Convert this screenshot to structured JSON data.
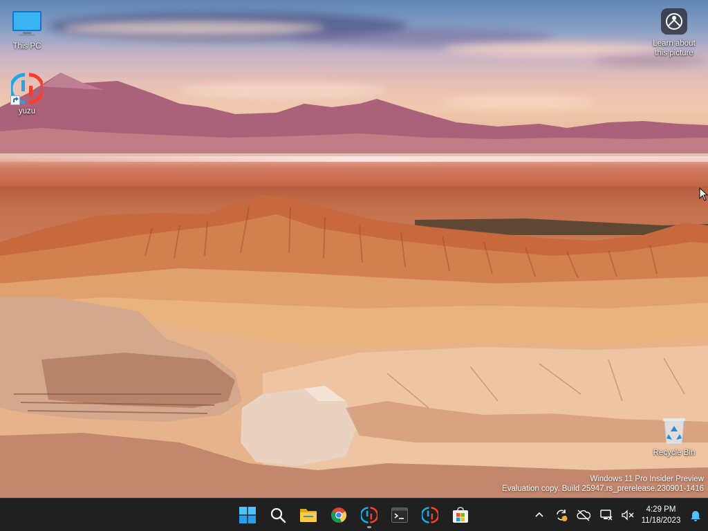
{
  "desktop": {
    "icons": [
      {
        "label": "This PC",
        "icon": "this-pc-icon"
      },
      {
        "label": "yuzu",
        "icon": "yuzu-icon"
      },
      {
        "label": "Recycle Bin",
        "icon": "recycle-bin-icon"
      }
    ],
    "learn_about": {
      "line1": "Learn about",
      "line2": "this picture",
      "icon": "camera-info-icon"
    }
  },
  "watermark": {
    "line1": "Windows 11 Pro Insider Preview",
    "line2": "Evaluation copy. Build 25947.rs_prerelease.230901-1416"
  },
  "taskbar": {
    "apps": [
      {
        "name": "start-button",
        "icon": "windows-logo-icon"
      },
      {
        "name": "search-button",
        "icon": "search-icon"
      },
      {
        "name": "file-explorer-button",
        "icon": "folder-icon"
      },
      {
        "name": "chrome-button",
        "icon": "chrome-icon"
      },
      {
        "name": "yuzu-taskbar-button",
        "icon": "yuzu-icon",
        "active": true
      },
      {
        "name": "terminal-button",
        "icon": "terminal-icon"
      },
      {
        "name": "yuzu-taskbar-button-2",
        "icon": "yuzu-icon"
      },
      {
        "name": "store-button",
        "icon": "store-icon"
      }
    ],
    "tray": {
      "icons": [
        "chevron-up-icon",
        "sync-icon",
        "cloud-off-icon",
        "network-icon",
        "volume-muted-icon"
      ],
      "time": "4:29 PM",
      "date": "11/18/2023",
      "notification_icon": "bell-icon"
    }
  },
  "colors": {
    "taskbar_bg": "#202020",
    "yuzu_blue": "#1ea7e8",
    "yuzu_red": "#ff3c28",
    "accent": "#4cc2ff"
  }
}
